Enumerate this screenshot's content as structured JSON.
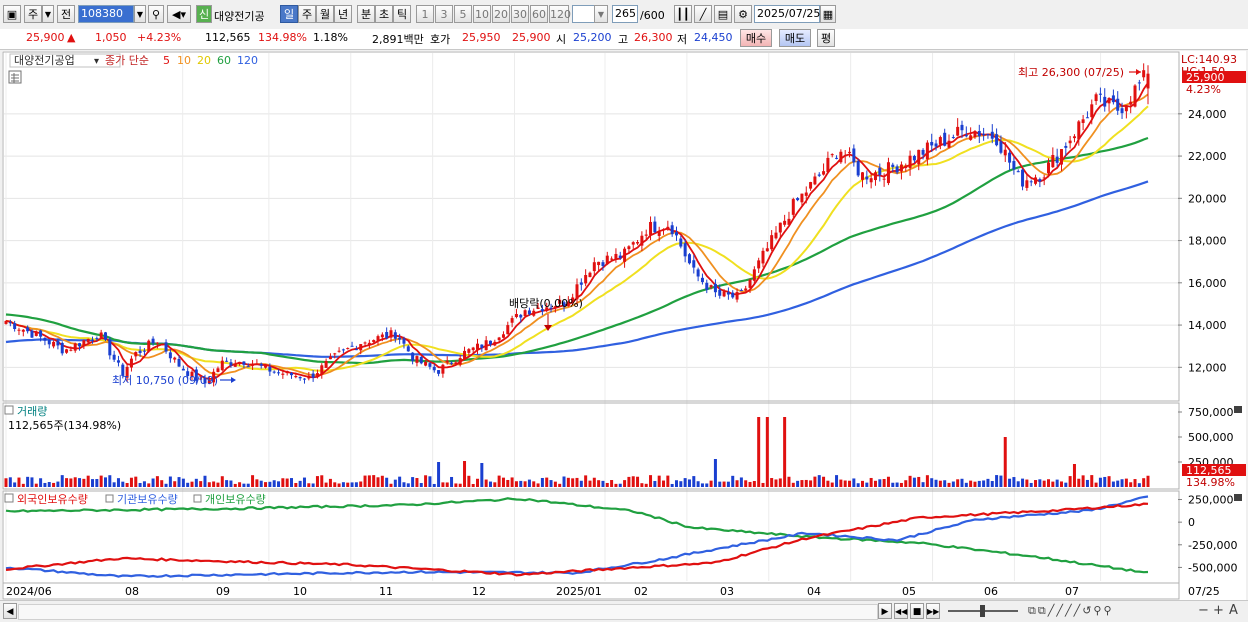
{
  "toolbar": {
    "market": "주",
    "scope": "전",
    "code": "108380",
    "stock_name": "대양전기공",
    "badge": "신",
    "periods": [
      "일",
      "주",
      "월",
      "년",
      "분",
      "초",
      "틱"
    ],
    "active_period": "일",
    "intervals": [
      "1",
      "3",
      "5",
      "10",
      "20",
      "30",
      "60",
      "120"
    ],
    "count": "265",
    "count_max": "/600",
    "date": "2025/07/25"
  },
  "quote": {
    "price": "25,900",
    "change": "1,050",
    "pct": "+4.23%",
    "volume": "112,565",
    "vol_ratio": "134.98%",
    "turnover": "1.18%",
    "amount": "2,891백만",
    "hoga_label": "호가",
    "ask": "25,950",
    "bid": "25,900",
    "open_label": "시",
    "open": "25,200",
    "high_label": "고",
    "high": "26,300",
    "low_label": "저",
    "low": "24,450",
    "buy": "매수",
    "sell": "매도",
    "eval": "평"
  },
  "price_panel": {
    "name": "대양전기공업",
    "legend_prefix": "종가 단순",
    "ma_legend": [
      "5",
      "10",
      "20",
      "60",
      "120"
    ],
    "lc": "LC:140.93",
    "hc": "HC:1.50",
    "last_price": "25,900",
    "last_pct": "4.23%",
    "max_label": "최고 26,300 (07/25)",
    "min_label": "최저 10,750 (09/09)",
    "event_label": "배당락(0.00%)",
    "y_ticks": [
      "24,000",
      "22,000",
      "20,000",
      "18,000",
      "16,000",
      "14,000",
      "12,000"
    ]
  },
  "volume_panel": {
    "title": "거래량",
    "info": "112,565주(134.98%)",
    "y_ticks": [
      "750,000",
      "500,000",
      "250,000"
    ],
    "last_volume": "112,565",
    "last_ratio": "134.98%"
  },
  "holding_panel": {
    "series_names": [
      "외국인보유수량",
      "기관보유수량",
      "개인보유수량"
    ],
    "y_ticks": [
      "250,000",
      "0",
      "-250,000",
      "-500,000"
    ]
  },
  "x_axis": {
    "labels": [
      "2024/06",
      "08",
      "09",
      "10",
      "11",
      "12",
      "2025/01",
      "02",
      "03",
      "04",
      "05",
      "06",
      "07"
    ],
    "end_label": "07/25"
  },
  "colors": {
    "up": "#e01010",
    "down": "#1a3fd0",
    "ma5": "#e01010",
    "ma10": "#f09020",
    "ma20": "#f0e020",
    "ma60": "#20a040",
    "ma120": "#3060e0"
  },
  "chart_data": {
    "type": "candlestick",
    "period": "daily",
    "x_range": [
      "2024/06",
      "2025/07/25"
    ],
    "ylim": [
      10500,
      26500
    ],
    "last": {
      "open": 25200,
      "high": 26300,
      "low": 24450,
      "close": 25900,
      "change": 1050,
      "pct": 4.23,
      "volume": 112565
    },
    "markers": [
      {
        "type": "high",
        "value": 26300,
        "date": "07/25"
      },
      {
        "type": "low",
        "value": 10750,
        "date": "09/09"
      },
      {
        "type": "event",
        "label": "배당락(0.00%)",
        "date": "2024/12"
      }
    ],
    "moving_averages": [
      "5",
      "10",
      "20",
      "60",
      "120"
    ],
    "volume_ylim": [
      0,
      800000
    ],
    "holding_ylim": [
      -650000,
      300000
    ],
    "holding_series": [
      "외국인보유수량",
      "기관보유수량",
      "개인보유수량"
    ]
  }
}
